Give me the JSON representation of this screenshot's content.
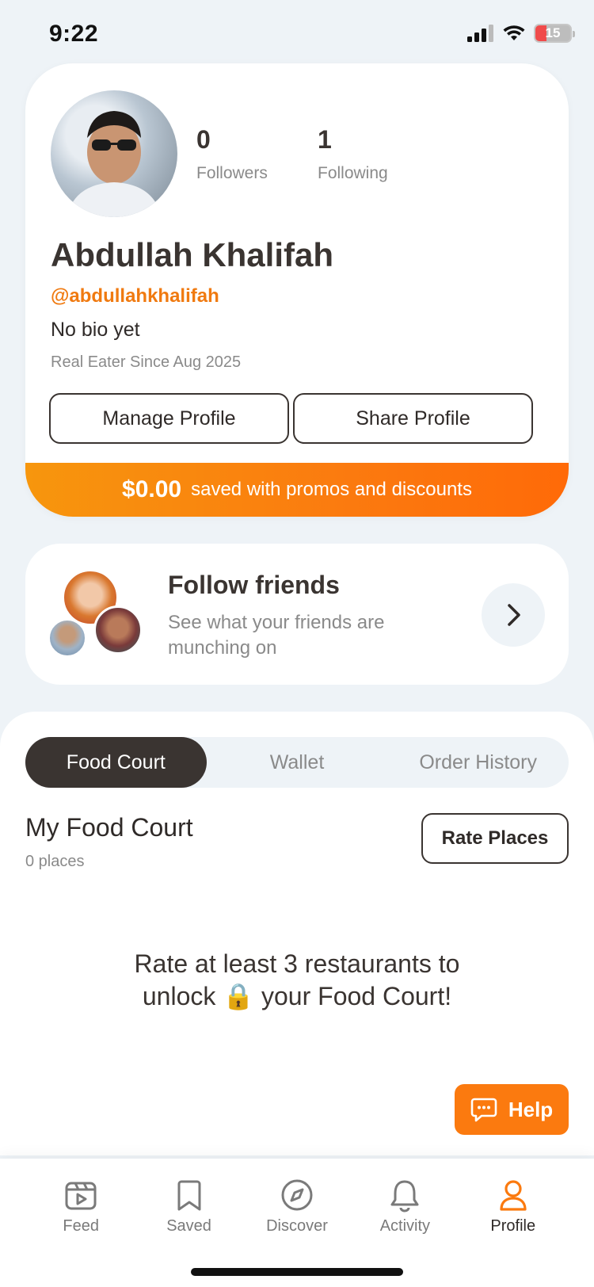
{
  "status_bar": {
    "time": "9:22",
    "battery": "15"
  },
  "profile": {
    "followers_count": "0",
    "followers_label": "Followers",
    "following_count": "1",
    "following_label": "Following",
    "name": "Abdullah Khalifah",
    "handle": "@abdullahkhalifah",
    "bio": "No bio yet",
    "member_since": "Real Eater Since Aug 2025",
    "manage_label": "Manage Profile",
    "share_label": "Share Profile",
    "savings_amount": "$0.00",
    "savings_text": "saved with promos and discounts"
  },
  "follow_friends": {
    "title": "Follow friends",
    "subtitle": "See what your friends are munching on"
  },
  "tabs": [
    {
      "label": "Food Court",
      "active": true
    },
    {
      "label": "Wallet",
      "active": false
    },
    {
      "label": "Order History",
      "active": false
    }
  ],
  "food_court": {
    "title": "My Food Court",
    "count": "0 places",
    "rate_label": "Rate Places",
    "unlock_text_1": "Rate at least 3 restaurants to unlock",
    "unlock_text_2": "your Food Court!"
  },
  "help": {
    "label": "Help"
  },
  "nav": [
    {
      "label": "Feed",
      "icon": "feed-icon",
      "active": false
    },
    {
      "label": "Saved",
      "icon": "bookmark-icon",
      "active": false
    },
    {
      "label": "Discover",
      "icon": "compass-icon",
      "active": false
    },
    {
      "label": "Activity",
      "icon": "bell-icon",
      "active": false
    },
    {
      "label": "Profile",
      "icon": "user-icon",
      "active": true
    }
  ],
  "colors": {
    "accent": "#fb7a0f",
    "dark": "#3a3431",
    "background": "#eef3f7"
  }
}
